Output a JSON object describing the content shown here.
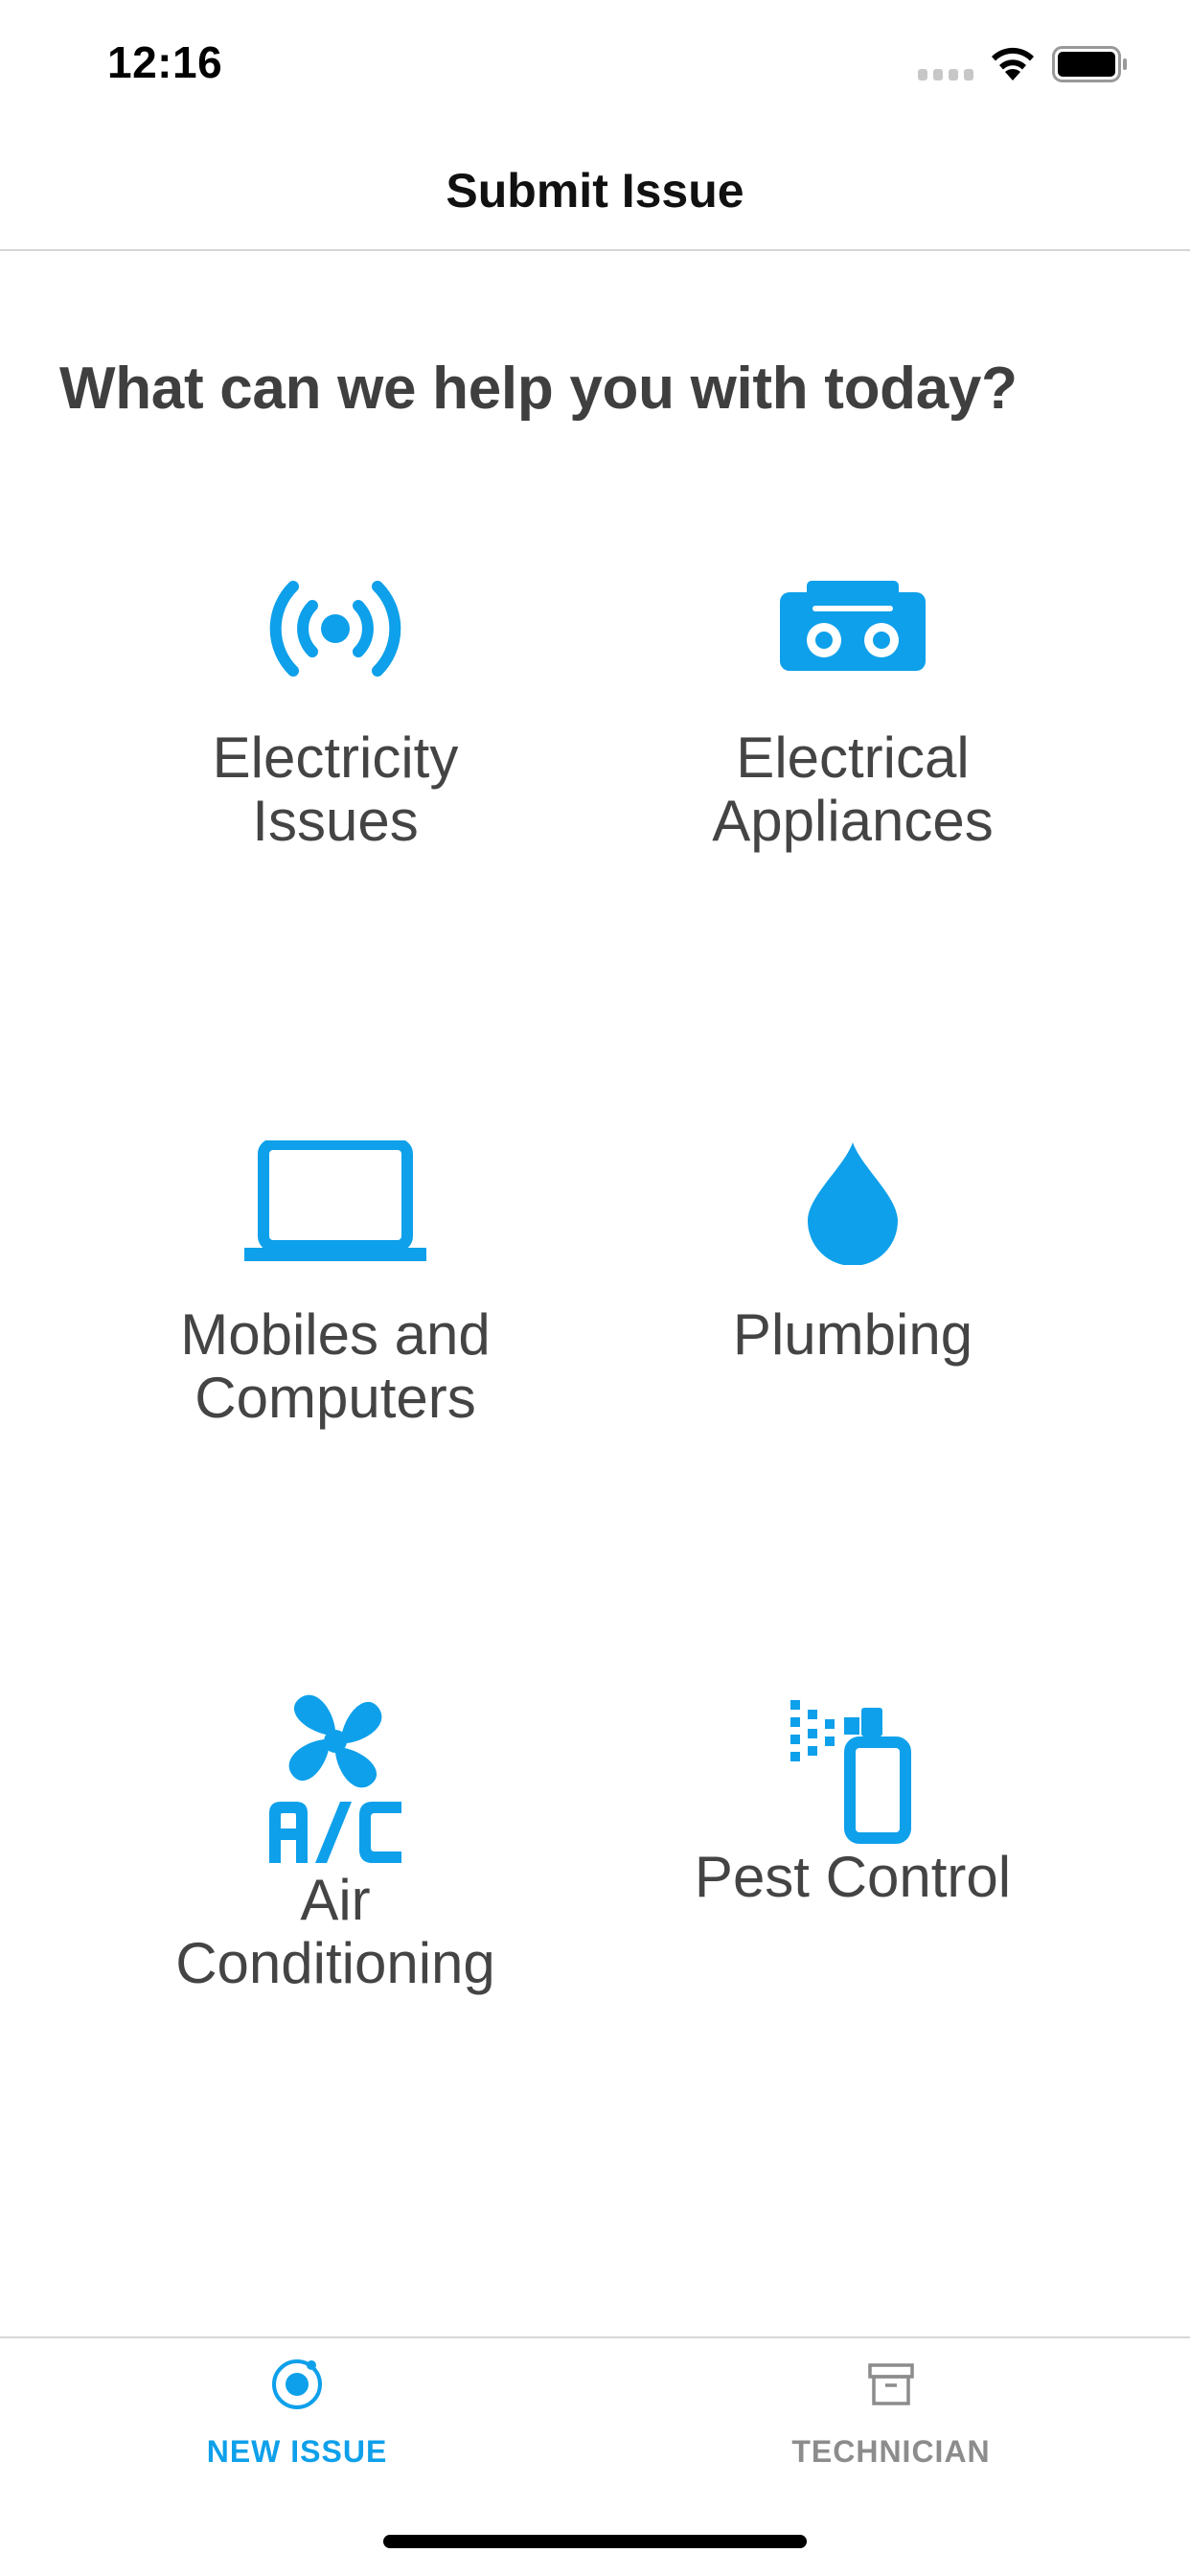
{
  "status_bar": {
    "time": "12:16"
  },
  "nav": {
    "title": "Submit Issue"
  },
  "heading": "What can we help you with today?",
  "accent_color": "#0ea0ea",
  "categories": [
    {
      "label": "Electricity Issues",
      "icon": "broadcast-icon"
    },
    {
      "label": "Electrical Appliances",
      "icon": "radio-icon"
    },
    {
      "label": "Mobiles and Computers",
      "icon": "laptop-icon"
    },
    {
      "label": "Plumbing",
      "icon": "water-drop-icon"
    },
    {
      "label": "Air Conditioning",
      "icon": "ac-fan-icon"
    },
    {
      "label": "Pest Control",
      "icon": "spray-bottle-icon"
    }
  ],
  "tabs": [
    {
      "label": "NEW ISSUE",
      "icon": "target-icon",
      "active": true
    },
    {
      "label": "TECHNICIAN",
      "icon": "archive-icon",
      "active": false
    }
  ]
}
